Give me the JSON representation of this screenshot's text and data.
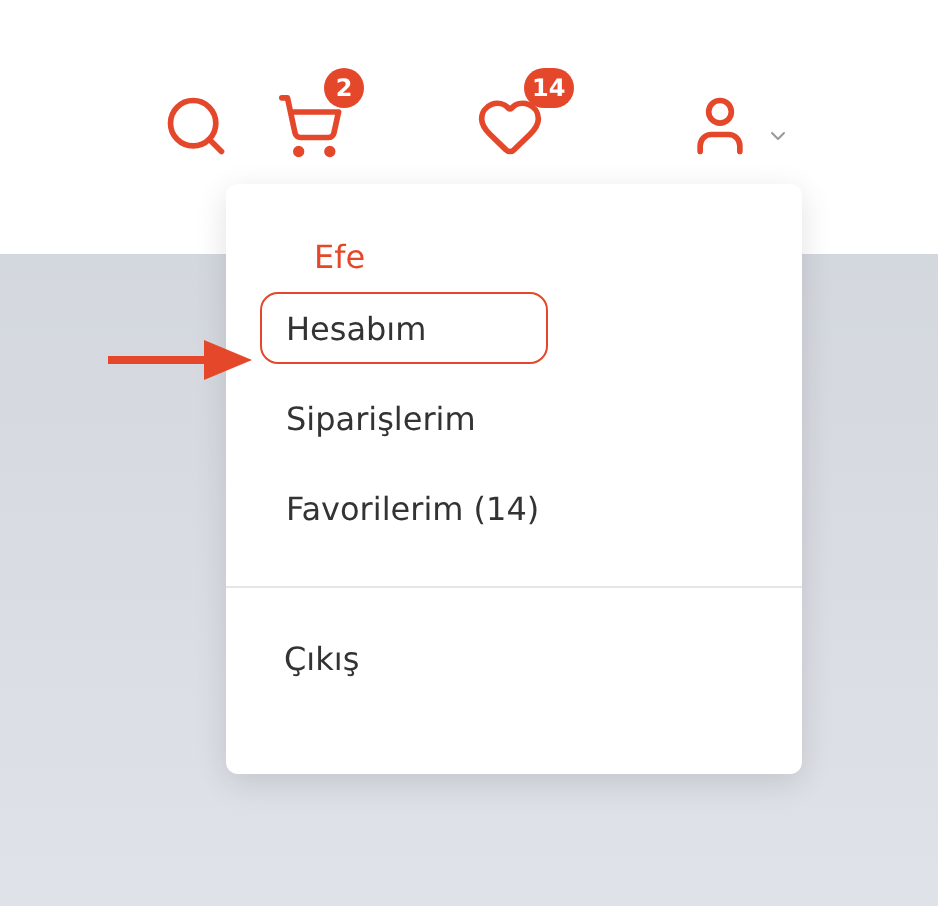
{
  "header": {
    "icons": [
      {
        "kind": "search"
      },
      {
        "kind": "cart",
        "badge": "2"
      },
      {
        "kind": "heart",
        "badge": "14"
      },
      {
        "kind": "user"
      }
    ]
  },
  "account_menu": {
    "user_name": "Efe",
    "items": [
      {
        "label": "Hesabım",
        "selected": true
      },
      {
        "label": "Siparişlerim",
        "selected": false
      },
      {
        "label": "Favorilerim (14)",
        "selected": false
      }
    ],
    "logout": "Çıkış"
  }
}
